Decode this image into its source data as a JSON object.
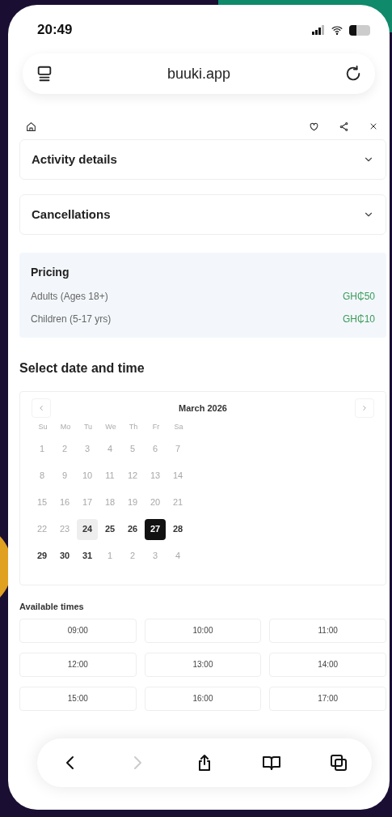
{
  "status_bar": {
    "time": "20:49"
  },
  "browser": {
    "url": "buuki.app"
  },
  "sections": [
    {
      "title": "Activity details",
      "expanded": false
    },
    {
      "title": "Cancellations",
      "expanded": false
    }
  ],
  "pricing": {
    "title": "Pricing",
    "rows": [
      {
        "label": "Adults (Ages 18+)",
        "price": "GH₵50"
      },
      {
        "label": "Children (5-17 yrs)",
        "price": "GH₵10"
      }
    ]
  },
  "booking": {
    "heading": "Select date and time",
    "month": "March 2026",
    "weekdays": [
      "Su",
      "Mo",
      "Tu",
      "We",
      "Th",
      "Fr",
      "Sa"
    ],
    "weeks": [
      [
        {
          "day": "1",
          "available": false,
          "selected": false,
          "today": false
        },
        {
          "day": "2",
          "available": false,
          "selected": false,
          "today": false
        },
        {
          "day": "3",
          "available": false,
          "selected": false,
          "today": false
        },
        {
          "day": "4",
          "available": false,
          "selected": false,
          "today": false
        },
        {
          "day": "5",
          "available": false,
          "selected": false,
          "today": false
        },
        {
          "day": "6",
          "available": false,
          "selected": false,
          "today": false
        },
        {
          "day": "7",
          "available": false,
          "selected": false,
          "today": false
        }
      ],
      [
        {
          "day": "8",
          "available": false,
          "selected": false,
          "today": false
        },
        {
          "day": "9",
          "available": false,
          "selected": false,
          "today": false
        },
        {
          "day": "10",
          "available": false,
          "selected": false,
          "today": false
        },
        {
          "day": "11",
          "available": false,
          "selected": false,
          "today": false
        },
        {
          "day": "12",
          "available": false,
          "selected": false,
          "today": false
        },
        {
          "day": "13",
          "available": false,
          "selected": false,
          "today": false
        },
        {
          "day": "14",
          "available": false,
          "selected": false,
          "today": false
        }
      ],
      [
        {
          "day": "15",
          "available": false,
          "selected": false,
          "today": false
        },
        {
          "day": "16",
          "available": false,
          "selected": false,
          "today": false
        },
        {
          "day": "17",
          "available": false,
          "selected": false,
          "today": false
        },
        {
          "day": "18",
          "available": false,
          "selected": false,
          "today": false
        },
        {
          "day": "19",
          "available": false,
          "selected": false,
          "today": false
        },
        {
          "day": "20",
          "available": false,
          "selected": false,
          "today": false
        },
        {
          "day": "21",
          "available": false,
          "selected": false,
          "today": false
        }
      ],
      [
        {
          "day": "22",
          "available": false,
          "selected": false,
          "today": false
        },
        {
          "day": "23",
          "available": false,
          "selected": false,
          "today": false
        },
        {
          "day": "24",
          "available": true,
          "selected": false,
          "today": true
        },
        {
          "day": "25",
          "available": true,
          "selected": false,
          "today": false
        },
        {
          "day": "26",
          "available": true,
          "selected": false,
          "today": false
        },
        {
          "day": "27",
          "available": true,
          "selected": true,
          "today": false
        },
        {
          "day": "28",
          "available": true,
          "selected": false,
          "today": false
        }
      ],
      [
        {
          "day": "29",
          "available": true,
          "selected": false,
          "today": false
        },
        {
          "day": "30",
          "available": true,
          "selected": false,
          "today": false
        },
        {
          "day": "31",
          "available": true,
          "selected": false,
          "today": false
        },
        {
          "day": "1",
          "available": false,
          "selected": false,
          "today": false
        },
        {
          "day": "2",
          "available": false,
          "selected": false,
          "today": false
        },
        {
          "day": "3",
          "available": false,
          "selected": false,
          "today": false
        },
        {
          "day": "4",
          "available": false,
          "selected": false,
          "today": false
        }
      ]
    ],
    "times_heading": "Available times",
    "times": [
      "09:00",
      "10:00",
      "11:00",
      "12:00",
      "13:00",
      "14:00",
      "15:00",
      "16:00",
      "17:00"
    ]
  }
}
